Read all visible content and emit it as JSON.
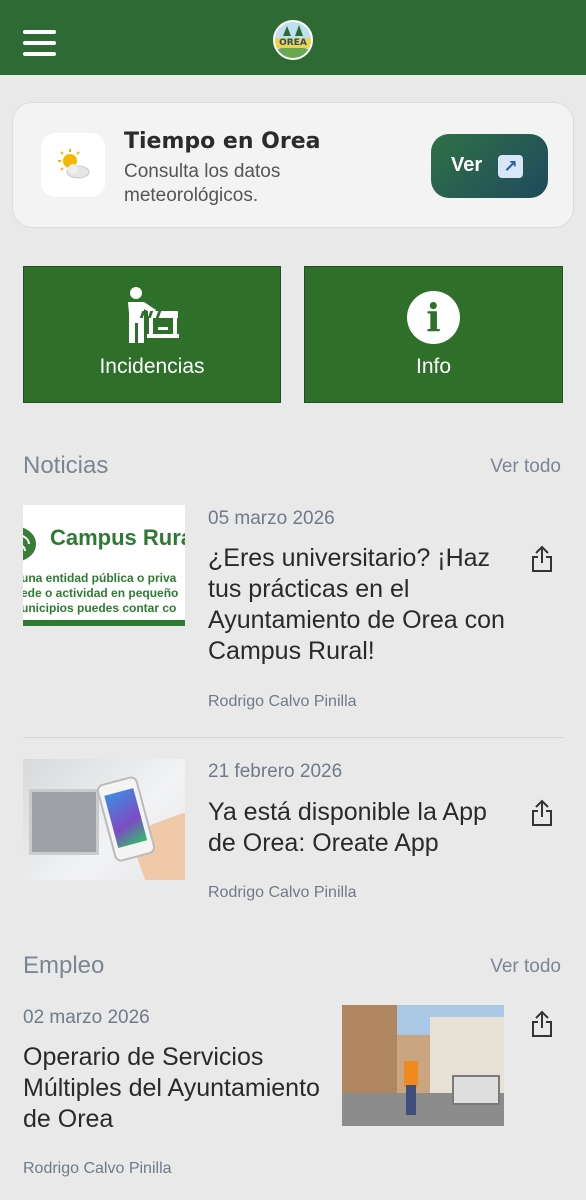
{
  "header": {
    "logo_text": "OREA"
  },
  "weather": {
    "title": "Tiempo en Orea",
    "subtitle": "Consulta los datos meteorológicos.",
    "button_label": "Ver",
    "icon": "sun-cloud-icon"
  },
  "tiles": [
    {
      "label": "Incidencias",
      "icon": "worker-barrier-icon"
    },
    {
      "label": "Info",
      "icon": "info-icon"
    }
  ],
  "news": {
    "section_title": "Noticias",
    "see_all": "Ver todo",
    "items": [
      {
        "date": "05 marzo 2026",
        "title": "¿Eres universitario? ¡Haz tus prácticas en el Ayuntamiento de Orea con Campus Rural!",
        "author": "Rodrigo Calvo Pinilla",
        "thumb_heading": "Campus Rura",
        "thumb_lines": [
          "una entidad pública o priva",
          "ede o actividad en pequeño",
          "unicipios puedes contar co"
        ]
      },
      {
        "date": "21 febrero 2026",
        "title": "Ya está disponible la App de Orea: Oreate App",
        "author": "Rodrigo Calvo Pinilla"
      }
    ]
  },
  "jobs": {
    "section_title": "Empleo",
    "see_all": "Ver todo",
    "items": [
      {
        "date": "02 marzo 2026",
        "title": "Operario de Servicios Múltiples del Ayuntamiento de Orea",
        "author": "Rodrigo Calvo Pinilla"
      }
    ]
  }
}
